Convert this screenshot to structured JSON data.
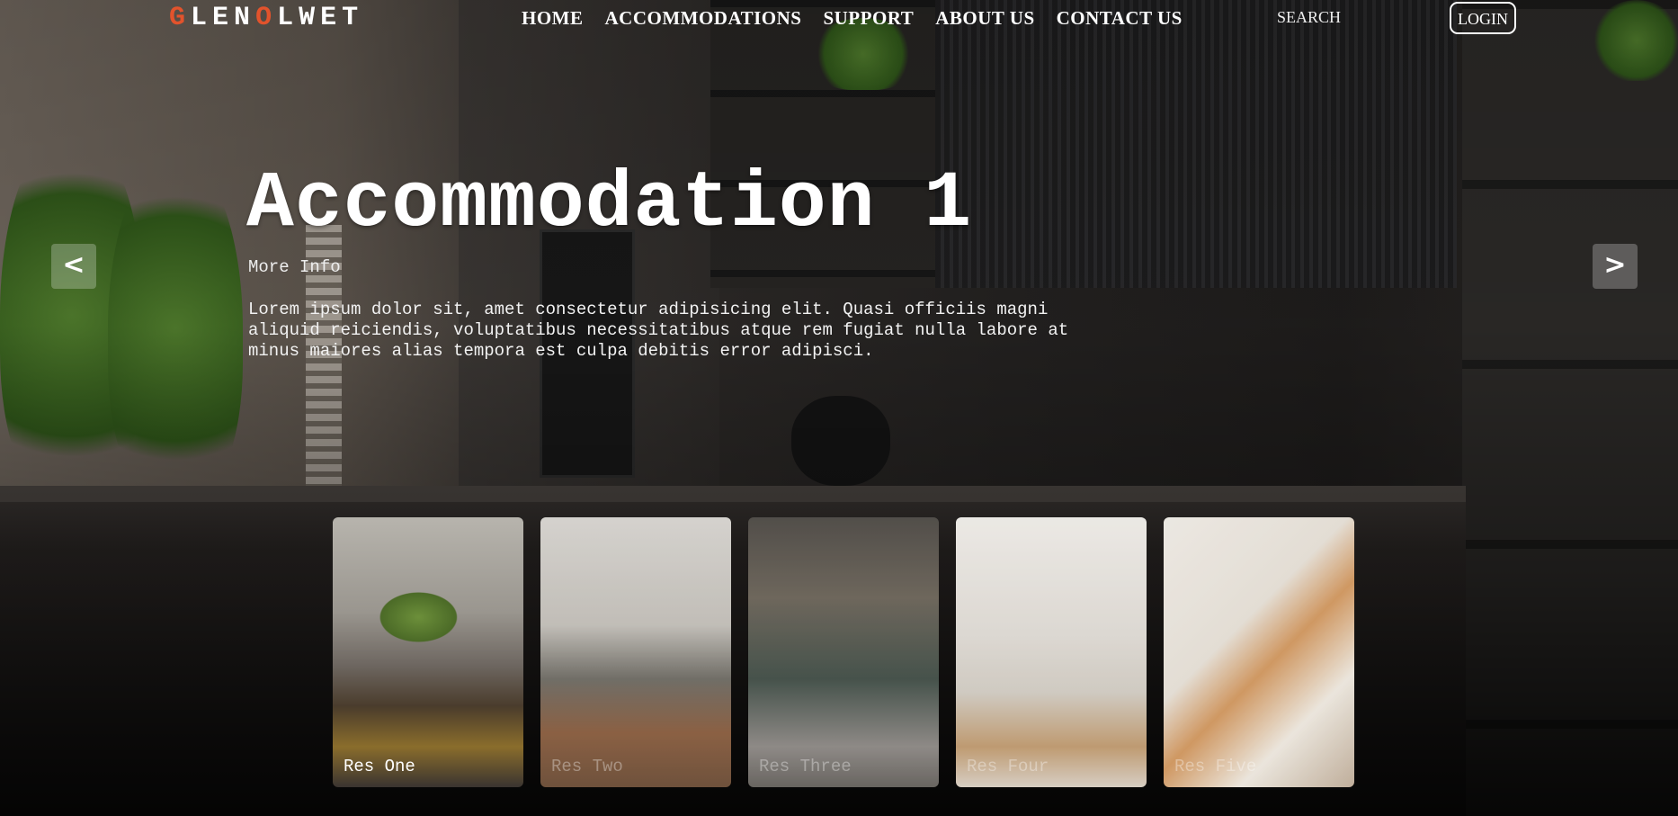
{
  "logo": {
    "letters": [
      "G",
      "L",
      "E",
      "N",
      "O",
      "L",
      "W",
      "E",
      "T"
    ],
    "accent_color": "#e2532c"
  },
  "nav": {
    "items": [
      {
        "label": "HOME"
      },
      {
        "label": "ACCOMMODATIONS"
      },
      {
        "label": "SUPPORT"
      },
      {
        "label": "ABOUT US"
      },
      {
        "label": "CONTACT US"
      }
    ],
    "search_label": "SEARCH",
    "login_label": "LOGIN"
  },
  "hero": {
    "title": "Accommodation 1",
    "more_info": "More Info",
    "description": "Lorem ipsum dolor sit, amet consectetur adipisicing elit. Quasi officiis magni aliquid reiciendis, voluptatibus necessitatibus atque rem fugiat nulla labore at minus maiores alias tempora est culpa debitis error adipisci."
  },
  "slider": {
    "prev_label": "<",
    "next_label": ">"
  },
  "cards": [
    {
      "label": "Res One"
    },
    {
      "label": "Res Two"
    },
    {
      "label": "Res Three"
    },
    {
      "label": "Res Four"
    },
    {
      "label": "Res Five"
    }
  ]
}
